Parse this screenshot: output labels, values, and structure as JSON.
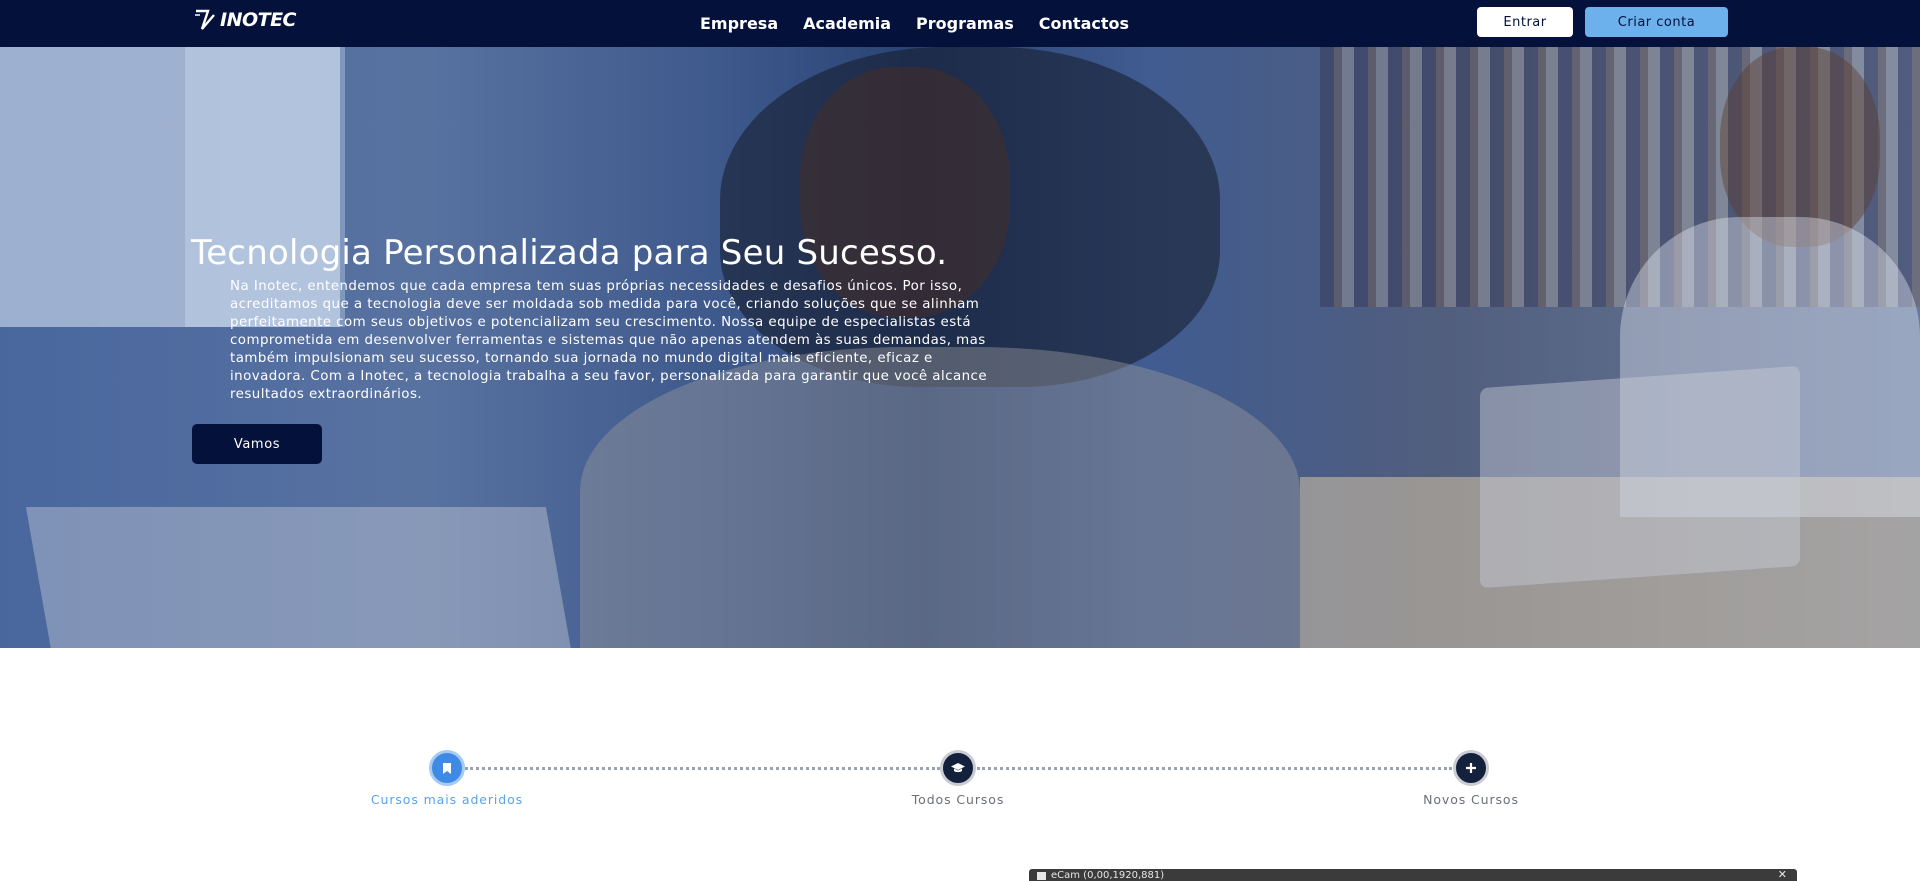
{
  "header": {
    "logo_text": "INOTEC",
    "nav": [
      {
        "label": "Empresa"
      },
      {
        "label": "Academia"
      },
      {
        "label": "Programas"
      },
      {
        "label": "Contactos"
      }
    ],
    "login_label": "Entrar",
    "signup_label": "Criar conta"
  },
  "hero": {
    "title": "Tecnologia Personalizada para Seu Sucesso.",
    "paragraph": "Na Inotec, entendemos que cada empresa tem suas próprias necessidades e desafios únicos. Por isso, acreditamos que a tecnologia deve ser moldada sob medida para você, criando soluções que se alinham perfeitamente com seus objetivos e potencializam seu crescimento. Nossa equipe de especialistas está comprometida em desenvolver ferramentas e sistemas que não apenas atendem às suas demandas, mas também impulsionam seu sucesso, tornando sua jornada no mundo digital mais eficiente, eficaz e inovadora. Com a Inotec, a tecnologia trabalha a seu favor, personalizada para garantir que você alcance resultados extraordinários.",
    "cta_label": "Vamos"
  },
  "steps": [
    {
      "label": "Cursos mais aderidos",
      "icon": "bookmark-icon",
      "active": true
    },
    {
      "label": "Todos Cursos",
      "icon": "graduation-cap-icon",
      "active": false
    },
    {
      "label": "Novos Cursos",
      "icon": "plus-icon",
      "active": false
    }
  ],
  "overlay": {
    "title": "eCam (0,00,1920,881)"
  },
  "colors": {
    "navbar": "#04113a",
    "accent": "#6cb0ec",
    "active_step": "#3f8ae6",
    "inactive_step": "#14213d"
  }
}
